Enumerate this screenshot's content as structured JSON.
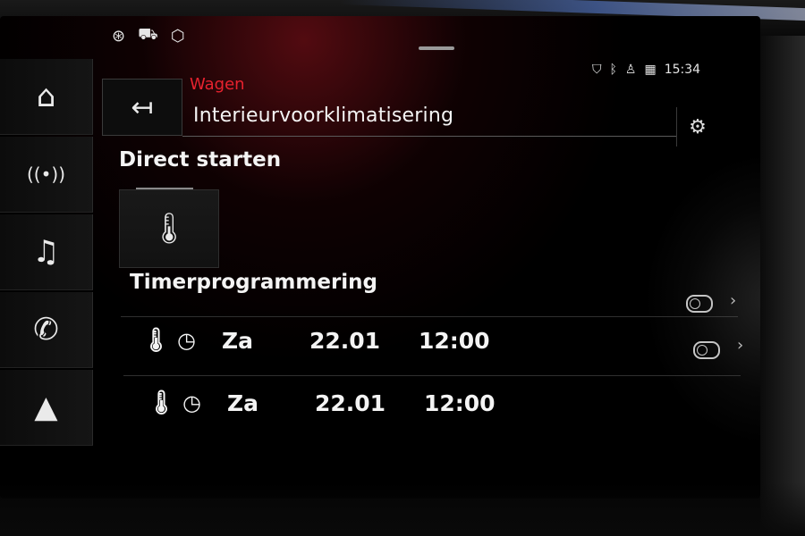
{
  "status": {
    "left_icons": [
      "satellite-icon",
      "car-service-icon",
      "package-icon"
    ],
    "right_icons": [
      "shield-icon",
      "bluetooth-icon",
      "person-icon",
      "signal-icon"
    ],
    "clock": "15:34"
  },
  "rail": {
    "items": [
      {
        "name": "home-icon",
        "glyph": "⌂"
      },
      {
        "name": "radio-icon",
        "glyph": "((•))"
      },
      {
        "name": "music-icon",
        "glyph": "♫"
      },
      {
        "name": "phone-icon",
        "glyph": "✆"
      },
      {
        "name": "navigation-icon",
        "glyph": "▲"
      }
    ]
  },
  "header": {
    "breadcrumb": "Wagen",
    "title": "Interieurvoorklimatisering",
    "back_glyph": "↤",
    "settings_glyph": "⚙"
  },
  "direct": {
    "heading": "Direct starten",
    "tile_glyph": "🌡"
  },
  "timer": {
    "heading": "Timerprogrammering",
    "rows": [
      {
        "day": "Za",
        "date": "22.01",
        "time": "12:00",
        "clock_glyph": "◷",
        "slot": "1",
        "enabled": false
      },
      {
        "day": "Za",
        "date": "22.01",
        "time": "12:00",
        "clock_glyph": "◷",
        "slot": "2",
        "enabled": false
      }
    ],
    "chevron": "›"
  },
  "colors": {
    "accent": "#e8222e",
    "text": "#f4f4f4",
    "background": "#000000"
  }
}
